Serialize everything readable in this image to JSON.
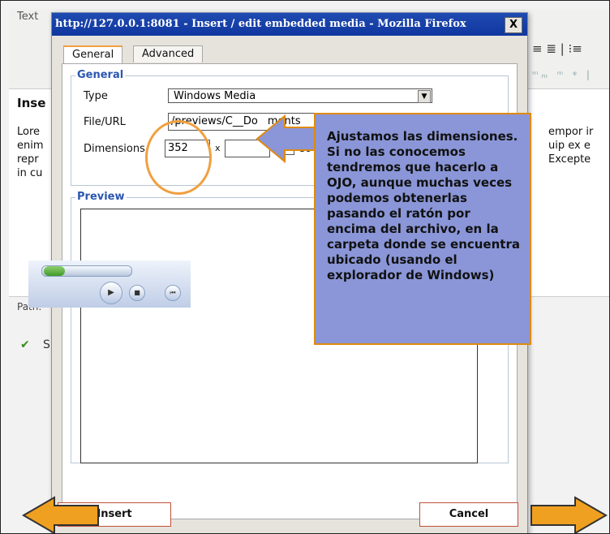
{
  "background": {
    "editor_title": "Text",
    "heading": "Inse",
    "left_text": [
      "Lore",
      "enim",
      "repr",
      "in cu"
    ],
    "right_text": [
      "empor ir",
      "uip ex e",
      "Excepte"
    ],
    "path_label": "Path:",
    "status_fragment": "S"
  },
  "dialog": {
    "title": "http://127.0.0.1:8081 - Insert / edit embedded media - Mozilla Firefox",
    "close_label": "X",
    "tabs": [
      {
        "label": "General",
        "active": true
      },
      {
        "label": "Advanced",
        "active": false
      }
    ],
    "general": {
      "legend": "General",
      "type_label": "Type",
      "type_value": "Windows Media",
      "file_label": "File/URL",
      "file_value": "/previews/C__Do",
      "file_value_tail": "ments",
      "dimensions_label": "Dimensions",
      "width_value": "352",
      "height_value": "",
      "times": "x",
      "constrain_fragment": "Co"
    },
    "preview": {
      "legend": "Preview"
    },
    "insert_label": "Insert",
    "cancel_label": "Cancel"
  },
  "callout": {
    "text": "Ajustamos las dimensiones. Si no las conocemos tendremos que hacerlo a OJO, aunque muchas veces podemos obtenerlas pasando el ratón por encima del archivo, en la carpeta donde se encuentra ubicado (usando el explorador de Windows)"
  },
  "colors": {
    "accent_orange": "#f0a040",
    "callout_bg": "#8a96d8",
    "title_blue": "#1f4bb0",
    "legend_blue": "#2b56b0"
  },
  "icons": [
    "check-icon",
    "dropdown-arrow-icon",
    "play-icon",
    "stop-icon",
    "prev-icon",
    "close-icon",
    "arrow-left-icon",
    "arrow-right-icon",
    "callout-arrow-icon"
  ]
}
